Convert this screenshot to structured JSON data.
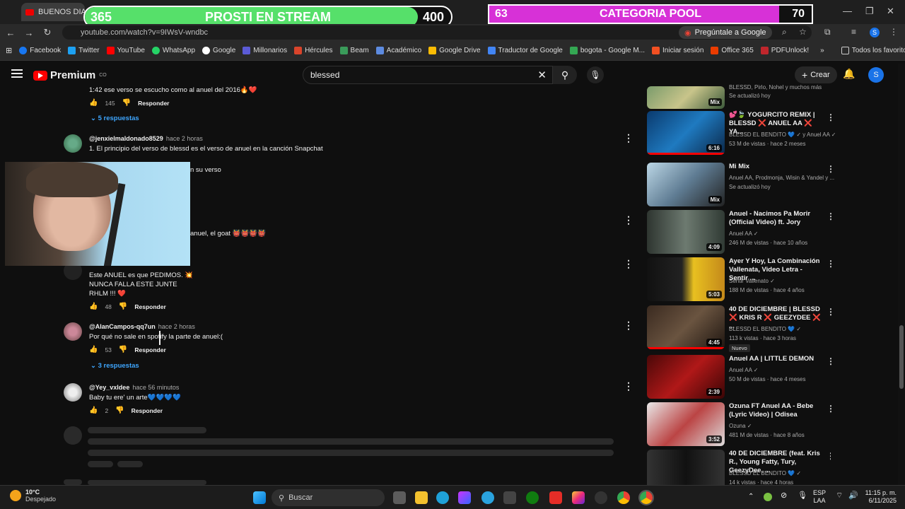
{
  "browser": {
    "tab_title": "BUENOS DIAS | B",
    "url": "youtube.com/watch?v=9IWsV-wndbc",
    "ask_google": "Pregúntale a Google",
    "bookmarks": [
      "Facebook",
      "Twitter",
      "YouTube",
      "WhatsApp",
      "Google",
      "Millonarios",
      "Hércules",
      "Beam",
      "Académico",
      "Google Drive",
      "Traductor de Google",
      "bogota - Google M...",
      "Iniciar sesión",
      "Office 365",
      "PDFUnlock!"
    ],
    "all_bookmarks": "Todos los favoritos"
  },
  "overlay": {
    "left": {
      "current": "365",
      "label": "PROSTI EN STREAM",
      "goal": "400",
      "progress": 0.91
    },
    "right": {
      "current": "63",
      "label": "CATEGORIA POOL",
      "goal": "70",
      "progress": 0.9
    }
  },
  "youtube": {
    "logo_text": "Premium",
    "logo_sup": "CO",
    "search_value": "blessed",
    "create_label": "Crear",
    "avatar_letter": "S"
  },
  "comments": {
    "top_partial": {
      "text": "1:42 ese verso se escucho como al anuel del 2016🔥❤️",
      "likes": "145",
      "reply": "Responder",
      "replies": "5 respuestas"
    },
    "c1": {
      "handle": "@jenxielmaldonado8529",
      "time": "hace 2 horas",
      "text": "1. El principio del verso de blessd es el verso de anuel en la canción Snapchat",
      "partial2": "n su verso"
    },
    "c2": {
      "text": "anuel, el goat 👹👹👹👹"
    },
    "c3": {
      "text1": "Este ANUEL es que PEDIMOS. 💥",
      "text2": "NUNCA FALLA ESTE JUNTE",
      "text3": "RHLM !!! ❤️",
      "likes": "48",
      "reply": "Responder"
    },
    "c4": {
      "handle": "@AlanCampos-qq7un",
      "time": "hace 2 horas",
      "text": "Por qué no sale en spotify la parte de anuel:(",
      "likes": "53",
      "reply": "Responder",
      "replies": "3 respuestas"
    },
    "c5": {
      "handle": "@Yey_vxldee",
      "time": "hace 56 minutos",
      "text": "Baby tu ere' un arte💙💙💙💙",
      "likes": "2",
      "reply": "Responder"
    }
  },
  "sidebar": [
    {
      "title": "",
      "meta1": "BLESSD, Pirlo, Nohel y muchos más",
      "meta2": "Se actualizó hoy",
      "badge_text": "Mix",
      "duration": ""
    },
    {
      "title": "💕🍃 YOGURCITO REMIX | BLESSD ❌ ANUEL AA ❌ YA...",
      "meta1": "BLESSD EL BENDITO 💙 ✓ y Anuel AA ✓",
      "meta2": "53 M de vistas · hace 2 meses",
      "duration": "6:16"
    },
    {
      "title": "Mi Mix",
      "meta1": "Anuel AA, Prodmonja, Wisin & Yandel y ...",
      "meta2": "Se actualizó hoy",
      "duration": "Mix"
    },
    {
      "title": "Anuel - Nacimos Pa Morir (Official Video) ft. Jory",
      "meta1": "Anuel AA ✓",
      "meta2": "246 M de vistas · hace 10 años",
      "duration": "4:09"
    },
    {
      "title": "Ayer Y Hoy, La Combinación Vallenata, Video Letra - Sentir ...",
      "meta1": "Sentir Vallenato ✓",
      "meta2": "188 M de vistas · hace 4 años",
      "duration": "5:03"
    },
    {
      "title": "40 DE DICIEMBRE | BLESSD ❌ KRIS R ❌ GEEZYDEE ❌ ...",
      "meta1": "BLESSD EL BENDITO 💙 ✓",
      "meta2": "113 k vistas · hace 3 horas",
      "badge": "Nuevo",
      "duration": "4:45"
    },
    {
      "title": "Anuel AA | LITTLE DEMON",
      "meta1": "Anuel AA ✓",
      "meta2": "50 M de vistas · hace 4 meses",
      "duration": "2:39"
    },
    {
      "title": "Ozuna FT Anuel AA - Bebe (Lyric Video) | Odisea",
      "meta1": "Ozuna ✓",
      "meta2": "481 M de vistas · hace 8 años",
      "duration": "3:52"
    },
    {
      "title": "40 DE DICIEMBRE (feat. Kris R., Young Fatty, Tury, GeezyDee, ...",
      "meta1": "BLESSD EL BENDITO 💙 ✓",
      "meta2": "14 k vistas · hace 4 horas",
      "duration": ""
    }
  ],
  "taskbar": {
    "temp": "10°C",
    "weather": "Despejado",
    "search": "Buscar",
    "lang1": "ESP",
    "lang2": "LAA",
    "time": "11:15 p. m.",
    "date": "6/11/2025"
  }
}
